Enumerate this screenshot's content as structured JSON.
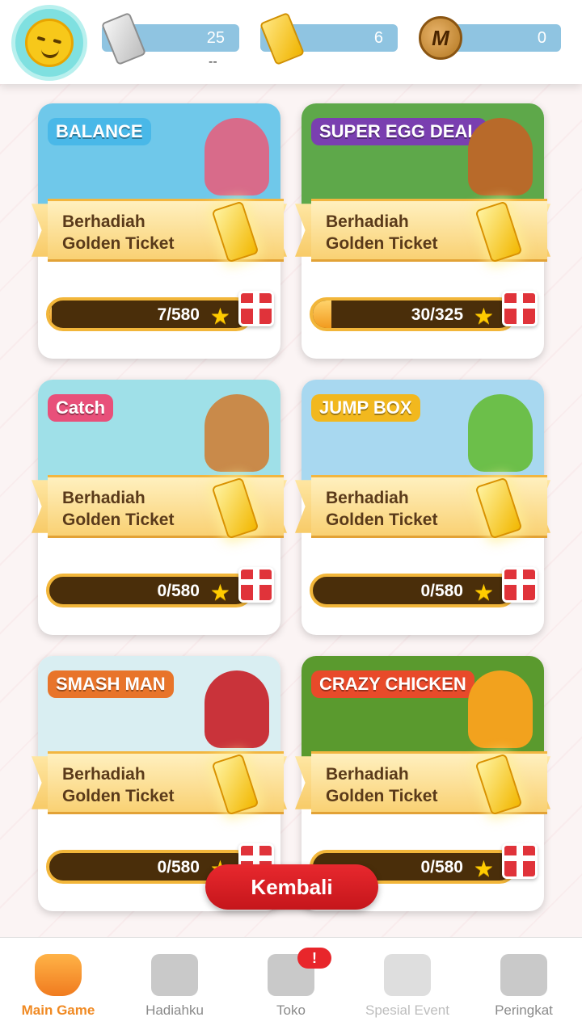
{
  "header": {
    "silver_ticket_count": "25",
    "silver_ticket_sub": "--",
    "golden_ticket_count": "6",
    "coin_count": "0",
    "coin_symbol": "M"
  },
  "games": [
    {
      "logo": "BALANCE",
      "ribbon_line1": "Berhadiah",
      "ribbon_line2": "Golden Ticket",
      "progress_text": "7/580",
      "progress": 0.012,
      "thumb_color": "#6fc8ea",
      "logo_color": "#49b8e8",
      "mascot_color": "#d86b8a"
    },
    {
      "logo": "SUPER EGG DEAL",
      "ribbon_line1": "Berhadiah",
      "ribbon_line2": "Golden Ticket",
      "progress_text": "30/325",
      "progress": 0.092,
      "thumb_color": "#5ea84a",
      "logo_color": "#7a3fb0",
      "mascot_color": "#b86a2a"
    },
    {
      "logo": "Catch",
      "ribbon_line1": "Berhadiah",
      "ribbon_line2": "Golden Ticket",
      "progress_text": "0/580",
      "progress": 0,
      "thumb_color": "#9fe0e8",
      "logo_color": "#e8507a",
      "mascot_color": "#c98a4a"
    },
    {
      "logo": "JUMP BOX",
      "ribbon_line1": "Berhadiah",
      "ribbon_line2": "Golden Ticket",
      "progress_text": "0/580",
      "progress": 0,
      "thumb_color": "#a8d8f0",
      "logo_color": "#f2b81e",
      "mascot_color": "#6cbf4a"
    },
    {
      "logo": "SMASH MAN",
      "ribbon_line1": "Berhadiah",
      "ribbon_line2": "Golden Ticket",
      "progress_text": "0/580",
      "progress": 0,
      "thumb_color": "#d9eef2",
      "logo_color": "#e8742a",
      "mascot_color": "#c9333a"
    },
    {
      "logo": "CRAZY CHICKEN",
      "ribbon_line1": "Berhadiah",
      "ribbon_line2": "Golden Ticket",
      "progress_text": "0/580",
      "progress": 0,
      "thumb_color": "#5a9a2e",
      "logo_color": "#e84a2a",
      "mascot_color": "#f2a21e"
    }
  ],
  "back_button": "Kembali",
  "nav": [
    {
      "label": "Main Game",
      "icon": "gamepad-icon",
      "state": "active"
    },
    {
      "label": "Hadiahku",
      "icon": "gift-box-icon",
      "state": "normal"
    },
    {
      "label": "Toko",
      "icon": "shop-icon",
      "state": "normal",
      "badge": "!"
    },
    {
      "label": "Spesial Event",
      "icon": "event-icon",
      "state": "dim"
    },
    {
      "label": "Peringkat",
      "icon": "trophy-icon",
      "state": "normal"
    }
  ],
  "colors": {
    "accent_red": "#d41f25",
    "active_orange": "#f08a23",
    "currency_bar": "#8fc4e1"
  }
}
